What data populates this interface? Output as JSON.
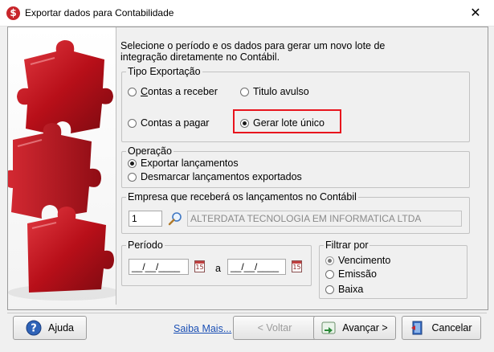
{
  "window": {
    "title": "Exportar dados para Contabilidade",
    "app_icon_glyph": "$",
    "close_glyph": "✕"
  },
  "intro": {
    "line1": "Selecione o período e os dados para gerar um novo lote de",
    "line2": "integração diretamente no Contábil."
  },
  "tipo_exportacao": {
    "legend": "Tipo Exportação",
    "options": [
      {
        "label": "Contas a receber",
        "checked": false
      },
      {
        "label": "Titulo avulso",
        "checked": false
      },
      {
        "label": "Contas a pagar",
        "checked": false
      },
      {
        "label": "Gerar lote único",
        "checked": true
      }
    ]
  },
  "operacao": {
    "legend": "Operação",
    "options": [
      {
        "label": "Exportar lançamentos",
        "checked": true
      },
      {
        "label": "Desmarcar lançamentos exportados",
        "checked": false
      }
    ]
  },
  "empresa": {
    "legend": "Empresa que receberá os lançamentos no Contábil",
    "code": "1",
    "name": "ALTERDATA TECNOLOGIA EM INFORMATICA LTDA",
    "search_icon": "magnifier-icon"
  },
  "periodo": {
    "legend": "Período",
    "start_value": "__/__/____",
    "separator": "a",
    "end_value": "__/__/____",
    "calendar_icon_label": "15"
  },
  "filtrar_por": {
    "legend": "Filtrar por",
    "options": [
      {
        "label": "Vencimento",
        "checked": true
      },
      {
        "label": "Emissão",
        "checked": false
      },
      {
        "label": "Baixa",
        "checked": false
      }
    ]
  },
  "footer": {
    "help_label": "Ajuda",
    "help_mnemonic": "j",
    "saiba_mais": "Saiba Mais...",
    "back_label": "< Voltar",
    "next_label": "Avançar >",
    "cancel_label": "Cancelar"
  },
  "colors": {
    "highlight_border": "#e8141d",
    "puzzle_red": "#c0161f",
    "link_blue": "#1a4fb4"
  }
}
